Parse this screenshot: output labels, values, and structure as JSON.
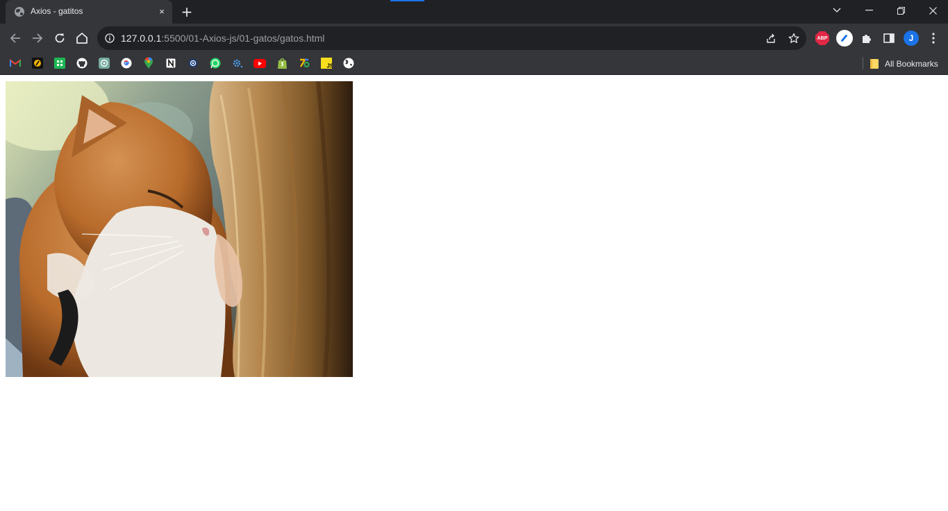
{
  "tab": {
    "title": "Axios - gatitos",
    "favicon": "globe-icon",
    "close": "×",
    "new_tab": "+"
  },
  "window_controls": [
    "tab-search-icon",
    "minimize-icon",
    "restore-icon",
    "close-icon"
  ],
  "toolbar": {
    "url_host": "127.0.0.1",
    "url_path": ":5500/01-Axios-js/01-gatos/gatos.html",
    "profile_initial": "J",
    "extensions": [
      "adblock-plus-icon",
      "extension-pen-icon",
      "puzzle-icon",
      "side-panel-icon"
    ],
    "abp_label": "ABP"
  },
  "bookmarks": {
    "items": [
      "gmail-icon",
      "bookmark-2-icon",
      "bookmark-3-icon",
      "github-icon",
      "chatgpt-icon",
      "google-icon",
      "maps-icon",
      "notion-icon",
      "bookmark-9-icon",
      "whatsapp-icon",
      "bookmark-11-icon",
      "youtube-icon",
      "shopify-icon",
      "bookmark-14-icon",
      "js-icon",
      "world-icon"
    ],
    "all_bookmarks_label": "All Bookmarks"
  },
  "content": {
    "image_subject": "orange and white cat nuzzling a girl with long blonde hair"
  },
  "colors": {
    "titlebar": "#202124",
    "toolbar": "#35363a",
    "accent": "#1a73e8"
  }
}
